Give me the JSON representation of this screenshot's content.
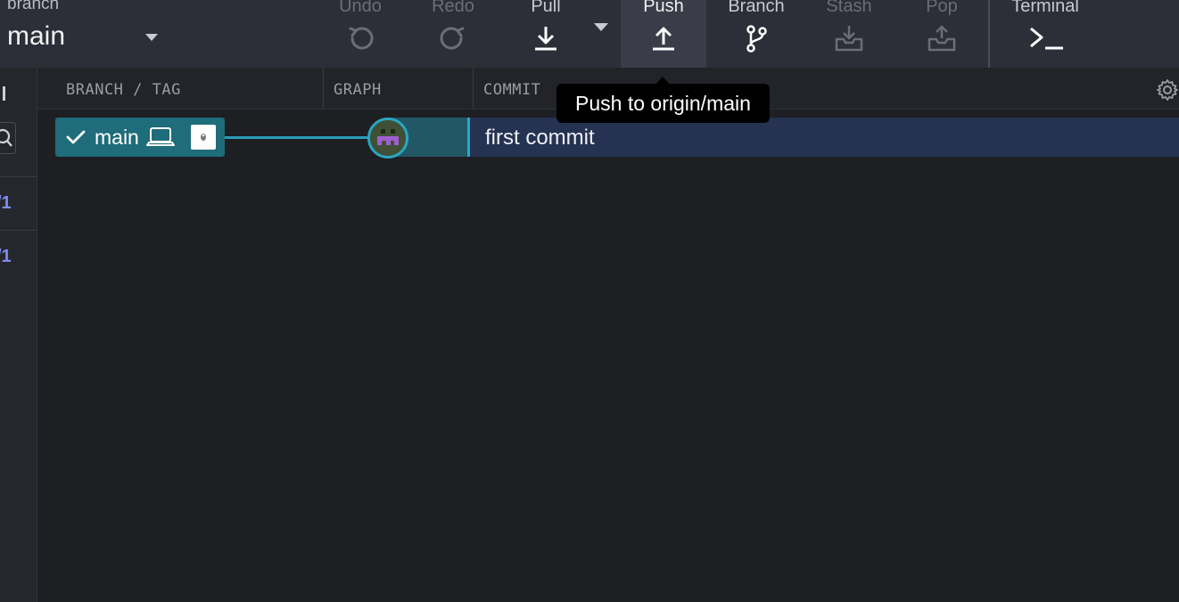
{
  "toolbar": {
    "branch_label": "branch",
    "branch_value": "main",
    "buttons": {
      "undo": {
        "label": "Undo",
        "icon": "undo-icon",
        "state": "disabled"
      },
      "redo": {
        "label": "Redo",
        "icon": "redo-icon",
        "state": "disabled"
      },
      "pull": {
        "label": "Pull",
        "icon": "download-arrow-icon",
        "state": "enabled"
      },
      "push": {
        "label": "Push",
        "icon": "upload-arrow-icon",
        "state": "active"
      },
      "branch": {
        "label": "Branch",
        "icon": "git-branch-icon",
        "state": "enabled"
      },
      "stash": {
        "label": "Stash",
        "icon": "stash-tray-icon",
        "state": "disabled"
      },
      "pop": {
        "label": "Pop",
        "icon": "pop-tray-icon",
        "state": "disabled"
      },
      "terminal": {
        "label": "Terminal",
        "icon": "terminal-icon",
        "state": "enabled"
      }
    }
  },
  "sidebar": {
    "counts": [
      "/1",
      "/1"
    ]
  },
  "graph": {
    "columns": {
      "branch_tag": "BRANCH / TAG",
      "graph": "GRAPH",
      "commit": "COMMIT"
    },
    "rows": [
      {
        "branch": "main",
        "checked": true,
        "message": "first commit"
      }
    ]
  },
  "tooltip": {
    "text": "Push to origin/main"
  },
  "colors": {
    "toolbar_bg": "#2d2f38",
    "content_bg": "#1e1f23",
    "branch_pill": "#1f6c7a",
    "selected_row": "#253252",
    "accent": "#2a9cb8",
    "sidebar_count": "#7b8df2"
  }
}
